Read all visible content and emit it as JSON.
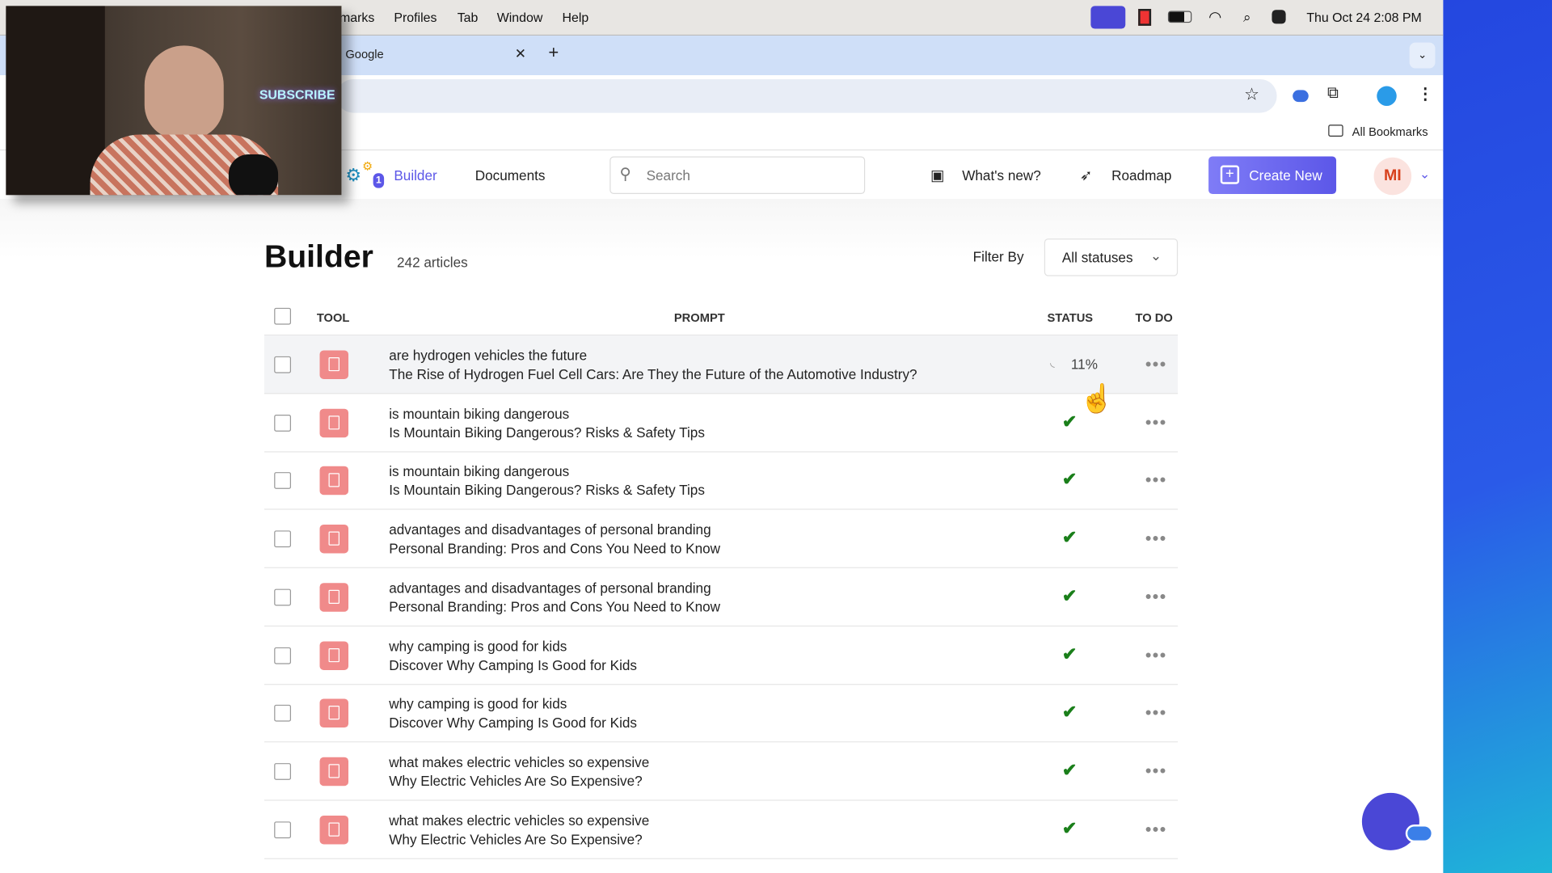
{
  "menubar": {
    "items": [
      "marks",
      "Profiles",
      "Tab",
      "Window",
      "Help"
    ],
    "datetime": "Thu Oct 24  2:08 PM"
  },
  "browser": {
    "tab_title": "Google",
    "bookmarks_label": "All Bookmarks"
  },
  "webcam": {
    "sign_text": "SUBSCRIBE"
  },
  "nav": {
    "badge": "1",
    "builder": "Builder",
    "documents": "Documents",
    "search_placeholder": "Search",
    "whats_new": "What's new?",
    "roadmap": "Roadmap",
    "create_new": "Create New",
    "avatar_initials": "MI"
  },
  "page": {
    "title": "Builder",
    "count": "242 articles",
    "filter_label": "Filter By",
    "filter_value": "All statuses"
  },
  "table": {
    "headers": {
      "tool": "TOOL",
      "prompt": "PROMPT",
      "status": "STATUS",
      "todo": "TO DO"
    },
    "rows": [
      {
        "keyword": "are hydrogen vehicles the future",
        "title": "The Rise of Hydrogen Fuel Cell Cars: Are They the Future of the Automotive Industry?",
        "status": "in-progress",
        "progress": "11%"
      },
      {
        "keyword": "is mountain biking dangerous",
        "title": "Is Mountain Biking Dangerous? Risks & Safety Tips",
        "status": "done"
      },
      {
        "keyword": "is mountain biking dangerous",
        "title": "Is Mountain Biking Dangerous? Risks & Safety Tips",
        "status": "done"
      },
      {
        "keyword": "advantages and disadvantages of personal branding",
        "title": "Personal Branding: Pros and Cons You Need to Know",
        "status": "done"
      },
      {
        "keyword": "advantages and disadvantages of personal branding",
        "title": "Personal Branding: Pros and Cons You Need to Know",
        "status": "done"
      },
      {
        "keyword": "why camping is good for kids",
        "title": "Discover Why Camping Is Good for Kids",
        "status": "done"
      },
      {
        "keyword": "why camping is good for kids",
        "title": "Discover Why Camping Is Good for Kids",
        "status": "done"
      },
      {
        "keyword": "what makes electric vehicles so expensive",
        "title": "Why Electric Vehicles Are So Expensive?",
        "status": "done"
      },
      {
        "keyword": "what makes electric vehicles so expensive",
        "title": "Why Electric Vehicles Are So Expensive?",
        "status": "done"
      }
    ]
  },
  "colors": {
    "accent": "#5c57e8",
    "done": "#1a7f1a",
    "doc_icon": "#f08a8a",
    "avatar_text": "#d8401c"
  }
}
